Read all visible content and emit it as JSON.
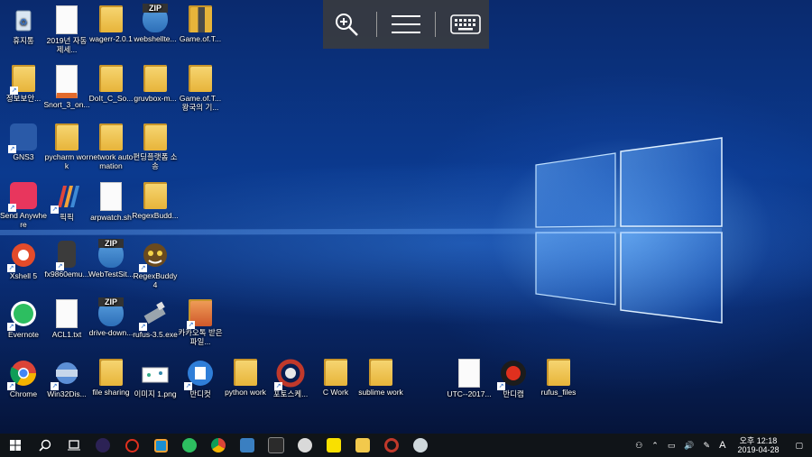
{
  "toolbar": {
    "zoom": "zoom-in",
    "menu": "menu",
    "keyboard": "keyboard"
  },
  "icons": [
    {
      "label": "휴지통"
    },
    {
      "label": "2019년 자동제세..."
    },
    {
      "label": "wagerr-2.0.1"
    },
    {
      "label": "webshellte..."
    },
    {
      "label": "Game.of.T..."
    },
    {
      "label": "정보보안..."
    },
    {
      "label": "Snort_3_on..."
    },
    {
      "label": "DoIt_C_So..."
    },
    {
      "label": "gruvbox-m..."
    },
    {
      "label": "Game.of.T... 왕국의 기..."
    },
    {
      "label": "GNS3"
    },
    {
      "label": "pycharm work"
    },
    {
      "label": "network automation"
    },
    {
      "label": "펀딩플랫폼 소송"
    },
    {
      "label": "Send Anywhere"
    },
    {
      "label": "픽픽"
    },
    {
      "label": "arpwatch.sh"
    },
    {
      "label": "RegexBudd..."
    },
    {
      "label": "Xshell 5"
    },
    {
      "label": "fx9860emu..."
    },
    {
      "label": "WebTestSit..."
    },
    {
      "label": "RegexBuddy 4"
    },
    {
      "label": "Evernote"
    },
    {
      "label": "ACL1.txt"
    },
    {
      "label": "drive-down..."
    },
    {
      "label": "rufus-3.5.exe"
    },
    {
      "label": "카카오톡 받은 파일..."
    },
    {
      "label": "Chrome"
    },
    {
      "label": "Win32Dis..."
    },
    {
      "label": "file sharing"
    },
    {
      "label": "이미지 1.png"
    },
    {
      "label": "반디컷"
    },
    {
      "label": "python work"
    },
    {
      "label": "포토스케..."
    },
    {
      "label": "C Work"
    },
    {
      "label": "sublime work"
    },
    {
      "label": "UTC--2017..."
    },
    {
      "label": "반디캠"
    },
    {
      "label": "rufus_files"
    }
  ],
  "tray": {
    "ime": "A",
    "time_line1": "오후 12:18",
    "time_line2": "2019-04-28"
  }
}
